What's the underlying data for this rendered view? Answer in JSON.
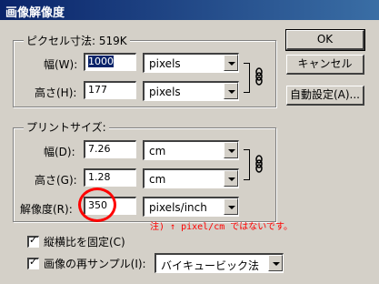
{
  "window": {
    "title": "画像解像度"
  },
  "pixel_size": {
    "legend": "ピクセル寸法:  519K",
    "width_label": "幅(W):",
    "width_value": "1000",
    "width_unit": "pixels",
    "height_label": "高さ(H):",
    "height_value": "177",
    "height_unit": "pixels"
  },
  "print_size": {
    "legend": "プリントサイズ:",
    "width_label": "幅(D):",
    "width_value": "7.26",
    "width_unit": "cm",
    "height_label": "高さ(G):",
    "height_value": "1.28",
    "height_unit": "cm",
    "resolution_label": "解像度(R):",
    "resolution_value": "350",
    "resolution_unit": "pixels/inch"
  },
  "buttons": {
    "ok": "OK",
    "cancel": "キャンセル",
    "auto": "自動設定(A)..."
  },
  "options": {
    "constrain_label": "縦横比を固定(C)",
    "constrain_checked": true,
    "resample_label": "画像の再サンプル(I):",
    "resample_checked": true,
    "resample_method": "バイキュービック法"
  },
  "annotation": {
    "note": "注) ↑  pixel/cm ではないです。",
    "color": "#ff0000"
  },
  "colors": {
    "titlebar_start": "#0a246a",
    "titlebar_end": "#3a6ea5",
    "dialog_bg": "#d4d0c8"
  }
}
